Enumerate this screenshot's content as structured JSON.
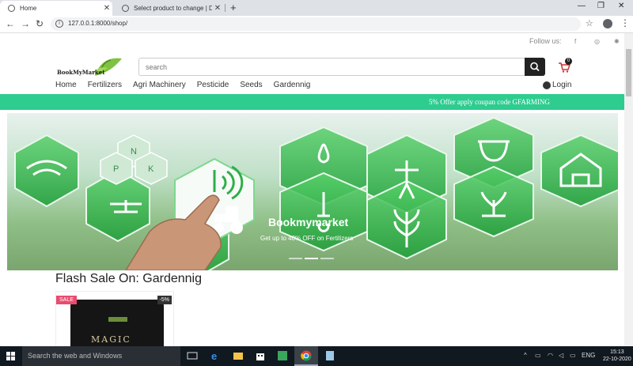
{
  "browser": {
    "tabs": [
      {
        "title": "Home",
        "active": true
      },
      {
        "title": "Select product to change | Djang",
        "active": false
      }
    ],
    "new_tab_glyph": "+",
    "url": "127.0.0.1:8000/shop/",
    "icons": [
      "back-arrow-icon",
      "forward-arrow-icon",
      "reload-icon",
      "info-icon",
      "star-icon",
      "profile-icon",
      "menu-kebab-icon"
    ]
  },
  "header": {
    "follow_label": "Follow us:",
    "social_icons": [
      "facebook-icon",
      "instagram-icon",
      "dribbble-icon"
    ],
    "logo_text": "BookMyMarket",
    "search_placeholder": "search",
    "cart_count": "0"
  },
  "nav": {
    "items": [
      "Home",
      "Fertilizers",
      "Agri Machinery",
      "Pesticide",
      "Seeds",
      "Gardennig"
    ],
    "login_label": "Login"
  },
  "promo": {
    "text": "5% Offer apply coupan code GFARMING",
    "color": "#2ecc8f"
  },
  "banner": {
    "title": "Bookmymarket",
    "subtitle": "Get up to 40% OFF on Fertilizers",
    "slide_count": 3,
    "active_slide": 2
  },
  "flash_sale": {
    "title": "Flash Sale On: Gardennig",
    "products": [
      {
        "badge": "SALE",
        "discount": "-5%",
        "package_text": "MAGIC SOIL"
      }
    ]
  },
  "taskbar": {
    "search_placeholder": "Search the web and Windows",
    "language": "ENG",
    "time": "15:13",
    "date": "22-10-2020"
  }
}
